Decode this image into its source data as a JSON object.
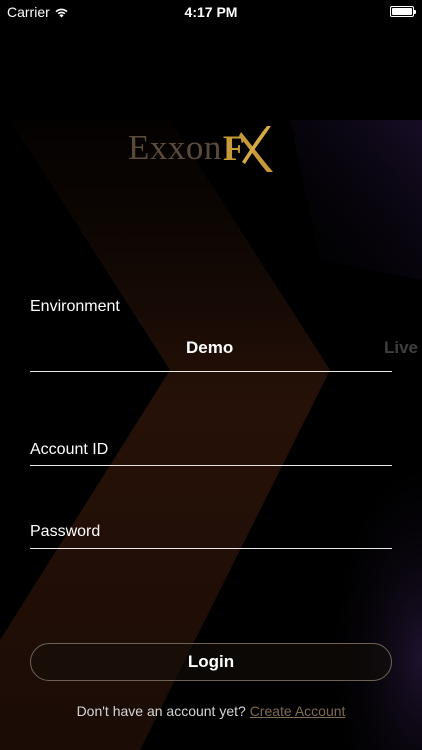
{
  "status_bar": {
    "carrier": "Carrier",
    "time": "4:17 PM",
    "battery_level": 1.0
  },
  "logo": {
    "word": "Exxon",
    "f_letter": "F",
    "x_icon": "x-swoosh-icon"
  },
  "form": {
    "environment": {
      "label": "Environment",
      "options": [
        "Demo",
        "Live"
      ],
      "selected": "Demo"
    },
    "account_id": {
      "label": "Account ID",
      "value": ""
    },
    "password": {
      "label": "Password",
      "value": ""
    }
  },
  "actions": {
    "login_label": "Login",
    "signup_prompt": "Don't have an account yet?",
    "signup_link": "Create Account"
  },
  "colors": {
    "background": "#000000",
    "accent_gold": "#c89b3a",
    "logo_brown": "#5a4a3a",
    "link": "#7e6a4f",
    "chevron_glow": "#3a1a0c"
  }
}
